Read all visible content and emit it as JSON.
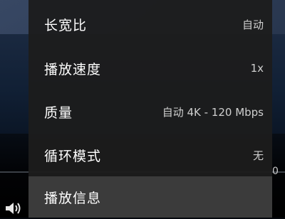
{
  "menu": {
    "items": [
      {
        "label": "长宽比",
        "value": "自动"
      },
      {
        "label": "播放速度",
        "value": "1x"
      },
      {
        "label": "质量",
        "value": "自动 4K - 120 Mbps"
      },
      {
        "label": "循环模式",
        "value": "无"
      },
      {
        "label": "播放信息",
        "value": ""
      }
    ]
  },
  "player": {
    "volume_icon": "speaker-icon",
    "right_fragment": "0"
  }
}
